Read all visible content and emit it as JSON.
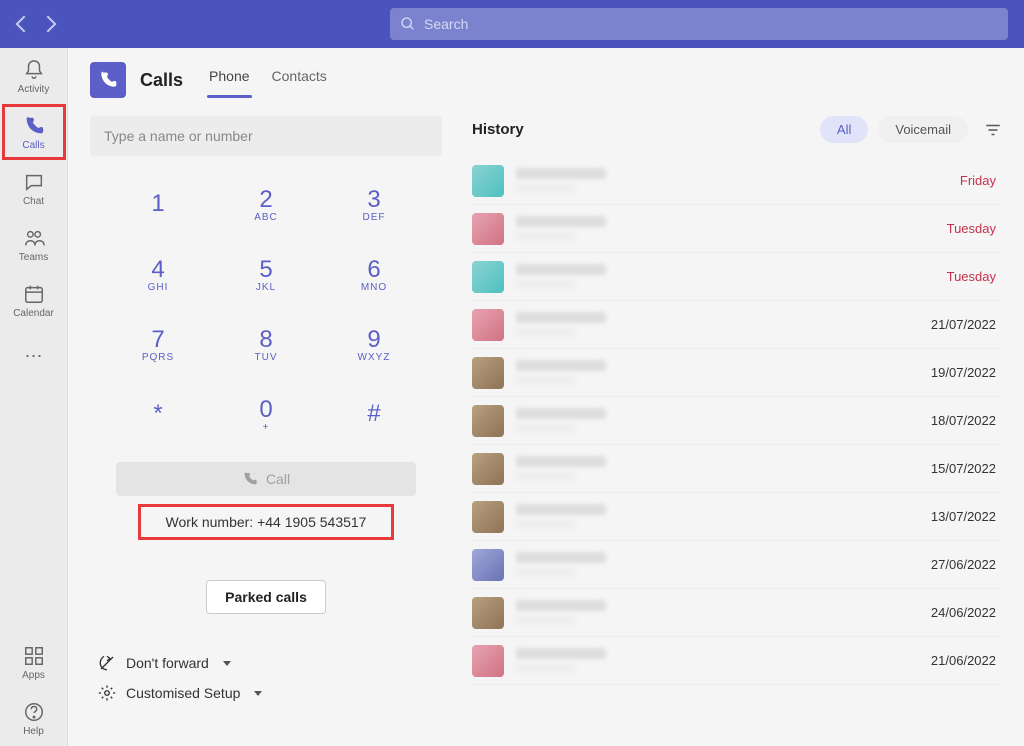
{
  "search": {
    "placeholder": "Search"
  },
  "sidebar": {
    "items": [
      {
        "label": "Activity"
      },
      {
        "label": "Calls"
      },
      {
        "label": "Chat"
      },
      {
        "label": "Teams"
      },
      {
        "label": "Calendar"
      }
    ],
    "apps": "Apps",
    "help": "Help"
  },
  "header": {
    "title": "Calls",
    "tabs": [
      {
        "label": "Phone",
        "active": true
      },
      {
        "label": "Contacts",
        "active": false
      }
    ]
  },
  "dialer": {
    "input_placeholder": "Type a name or number",
    "keys": [
      {
        "num": "1",
        "sub": ""
      },
      {
        "num": "2",
        "sub": "ABC"
      },
      {
        "num": "3",
        "sub": "DEF"
      },
      {
        "num": "4",
        "sub": "GHI"
      },
      {
        "num": "5",
        "sub": "JKL"
      },
      {
        "num": "6",
        "sub": "MNO"
      },
      {
        "num": "7",
        "sub": "PQRS"
      },
      {
        "num": "8",
        "sub": "TUV"
      },
      {
        "num": "9",
        "sub": "WXYZ"
      },
      {
        "num": "*",
        "sub": ""
      },
      {
        "num": "0",
        "sub": "+"
      },
      {
        "num": "#",
        "sub": ""
      }
    ],
    "call_label": "Call",
    "work_number": "Work number: +44 1905 543517",
    "parked_calls": "Parked calls",
    "forward": "Don't forward",
    "setup": "Customised Setup"
  },
  "history": {
    "title": "History",
    "filters": {
      "all": "All",
      "voicemail": "Voicemail"
    },
    "items": [
      {
        "date": "Friday",
        "missed": true,
        "avatar": "g0"
      },
      {
        "date": "Tuesday",
        "missed": true,
        "avatar": "g1"
      },
      {
        "date": "Tuesday",
        "missed": true,
        "avatar": "g0"
      },
      {
        "date": "21/07/2022",
        "missed": false,
        "avatar": "g1"
      },
      {
        "date": "19/07/2022",
        "missed": false,
        "avatar": "g2"
      },
      {
        "date": "18/07/2022",
        "missed": false,
        "avatar": "g2"
      },
      {
        "date": "15/07/2022",
        "missed": false,
        "avatar": "g2"
      },
      {
        "date": "13/07/2022",
        "missed": false,
        "avatar": "g2"
      },
      {
        "date": "27/06/2022",
        "missed": false,
        "avatar": "g3"
      },
      {
        "date": "24/06/2022",
        "missed": false,
        "avatar": "g2"
      },
      {
        "date": "21/06/2022",
        "missed": false,
        "avatar": "g1"
      }
    ]
  }
}
